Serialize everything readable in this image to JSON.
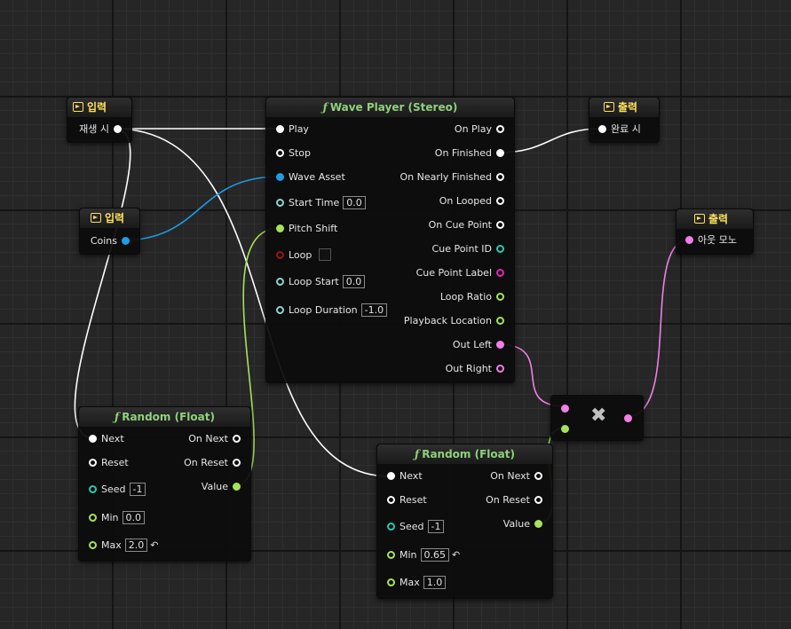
{
  "colors": {
    "exec": "#ffffff",
    "float": "#a6e35a",
    "audio": "#f07fe6",
    "asset": "#1e9ce6",
    "int": "#27c9b4",
    "string": "#e026b8",
    "bool": "#9a1515",
    "header_text": "#8fd17b",
    "io_header_text": "#ffe25c"
  },
  "input_node_1": {
    "title": "입력",
    "pin": "재생 시"
  },
  "input_node_2": {
    "title": "입력",
    "pin": "Coins"
  },
  "output_node_1": {
    "title": "출력",
    "pin": "완료 시"
  },
  "output_node_2": {
    "title": "출력",
    "pin": "아웃 모노"
  },
  "wave_player": {
    "title": "Wave Player (Stereo)",
    "inputs": {
      "play": "Play",
      "stop": "Stop",
      "wave_asset": "Wave Asset",
      "start_time": "Start Time",
      "start_time_value": "0.0",
      "pitch_shift": "Pitch Shift",
      "loop": "Loop",
      "loop_start": "Loop Start",
      "loop_start_value": "0.0",
      "loop_duration": "Loop Duration",
      "loop_duration_value": "-1.0"
    },
    "outputs": {
      "on_play": "On Play",
      "on_finished": "On Finished",
      "on_nearly_finished": "On Nearly Finished",
      "on_looped": "On Looped",
      "on_cue_point": "On Cue Point",
      "cue_point_id": "Cue Point ID",
      "cue_point_label": "Cue Point Label",
      "loop_ratio": "Loop Ratio",
      "playback_location": "Playback Location",
      "out_left": "Out Left",
      "out_right": "Out Right"
    }
  },
  "random_1": {
    "title": "Random (Float)",
    "next": "Next",
    "reset": "Reset",
    "seed": "Seed",
    "seed_value": "-1",
    "min": "Min",
    "min_value": "0.0",
    "max": "Max",
    "max_value": "2.0",
    "on_next": "On Next",
    "on_reset": "On Reset",
    "value": "Value"
  },
  "random_2": {
    "title": "Random (Float)",
    "next": "Next",
    "reset": "Reset",
    "seed": "Seed",
    "seed_value": "-1",
    "min": "Min",
    "min_value": "0.65",
    "max": "Max",
    "max_value": "1.0",
    "on_next": "On Next",
    "on_reset": "On Reset",
    "value": "Value"
  },
  "multiply_node": {
    "symbol": "✖"
  }
}
